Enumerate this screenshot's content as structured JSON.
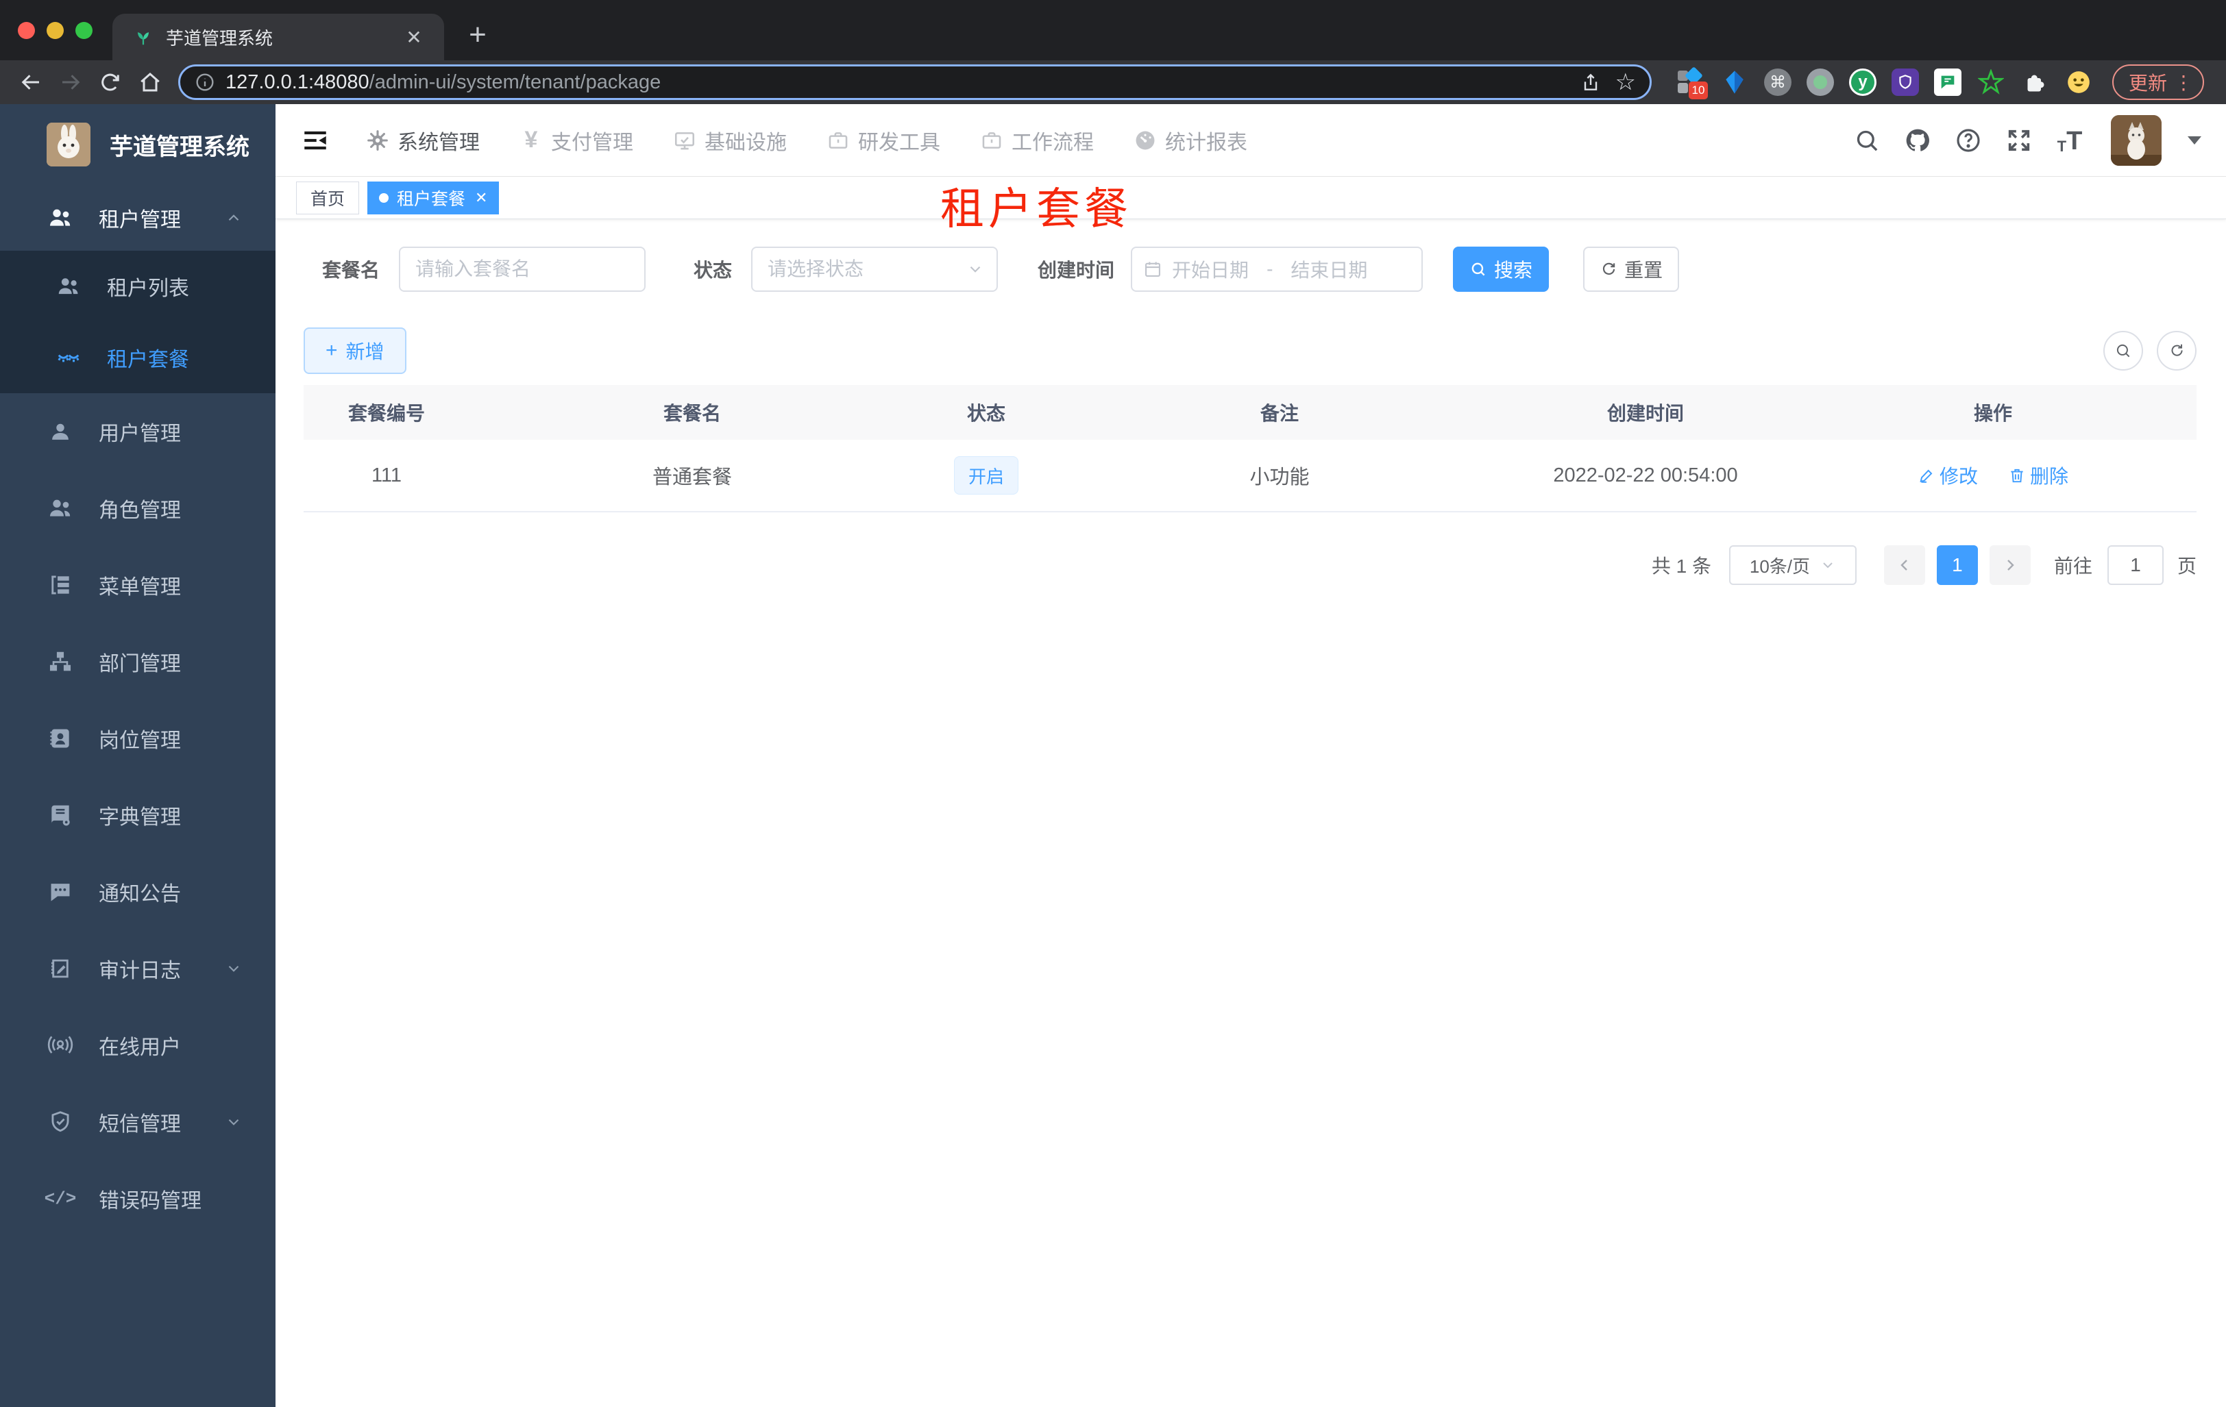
{
  "browser": {
    "tab_title": "芋道管理系统",
    "url_host": "127.0.0.1:48080",
    "url_path": "/admin-ui/system/tenant/package",
    "extension_badge": "10",
    "update_label": "更新"
  },
  "sidebar": {
    "app_title": "芋道管理系统",
    "items": {
      "tenant": "租户管理",
      "tenant_list": "租户列表",
      "tenant_package": "租户套餐",
      "user": "用户管理",
      "role": "角色管理",
      "menu": "菜单管理",
      "dept": "部门管理",
      "post": "岗位管理",
      "dict": "字典管理",
      "notice": "通知公告",
      "audit": "审计日志",
      "online": "在线用户",
      "sms": "短信管理",
      "errcode": "错误码管理"
    }
  },
  "header": {
    "nav": [
      "系统管理",
      "支付管理",
      "基础设施",
      "研发工具",
      "工作流程",
      "统计报表"
    ]
  },
  "tags": {
    "home": "首页",
    "active": "租户套餐"
  },
  "page_title_overlay": "租户套餐",
  "filters": {
    "name_label": "套餐名",
    "name_placeholder": "请输入套餐名",
    "status_label": "状态",
    "status_placeholder": "请选择状态",
    "date_label": "创建时间",
    "date_start_placeholder": "开始日期",
    "date_separator": "-",
    "date_end_placeholder": "结束日期",
    "search_label": "搜索",
    "reset_label": "重置"
  },
  "actions": {
    "add_label": "新增"
  },
  "table": {
    "headers": [
      "套餐编号",
      "套餐名",
      "状态",
      "备注",
      "创建时间",
      "操作"
    ],
    "rows": [
      {
        "id": "111",
        "name": "普通套餐",
        "status": "开启",
        "remark": "小功能",
        "created_at": "2022-02-22 00:54:00",
        "edit_label": "修改",
        "delete_label": "删除"
      }
    ]
  },
  "pagination": {
    "total_label": "共 1 条",
    "page_size_label": "10条/页",
    "current_page": "1",
    "goto_label": "前往",
    "goto_value": "1",
    "page_unit_label": "页"
  },
  "colors": {
    "primary": "#409eff",
    "overlay_red": "#f5270b",
    "sidebar_bg": "#304156",
    "submenu_bg": "#1f2d3d"
  }
}
